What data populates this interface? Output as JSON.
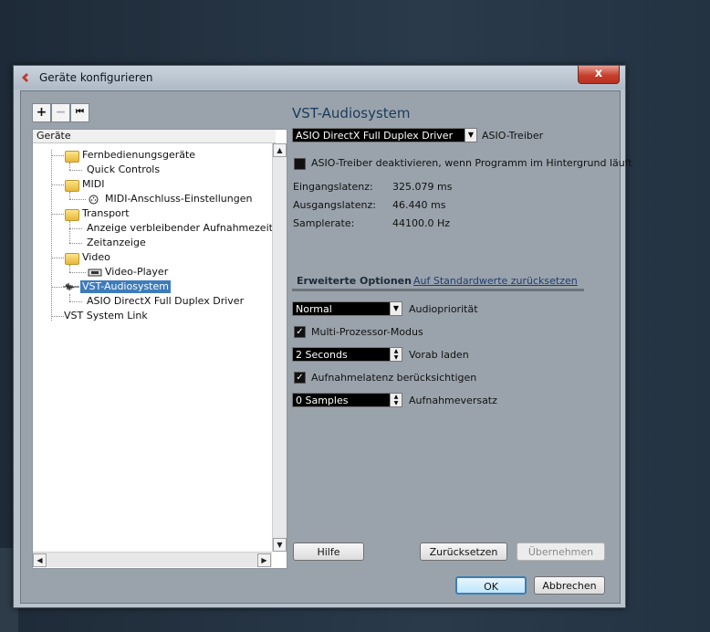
{
  "window": {
    "title": "Geräte konfigurieren",
    "close": "x"
  },
  "toolbar": {
    "add": "+",
    "remove": "−",
    "reset": "⏮"
  },
  "tree": {
    "header": "Geräte",
    "items": [
      {
        "label": "Fernbedienungsgeräte"
      },
      {
        "label": "Quick Controls"
      },
      {
        "label": "MIDI"
      },
      {
        "label": "MIDI-Anschluss-Einstellungen"
      },
      {
        "label": "Transport"
      },
      {
        "label": "Anzeige verbleibender Aufnahmezeit"
      },
      {
        "label": "Zeitanzeige"
      },
      {
        "label": "Video"
      },
      {
        "label": "Video-Player"
      },
      {
        "label": "VST-Audiosystem"
      },
      {
        "label": "ASIO DirectX Full Duplex Driver"
      },
      {
        "label": "VST System Link"
      }
    ]
  },
  "panel": {
    "title": "VST-Audiosystem",
    "driver_value": "ASIO DirectX Full Duplex Driver",
    "driver_label": "ASIO-Treiber",
    "deactivate_label": "ASIO-Treiber deaktivieren, wenn Programm im Hintergrund läuft",
    "in_latency_label": "Eingangslatenz:",
    "in_latency_value": "325.079 ms",
    "out_latency_label": "Ausgangslatenz:",
    "out_latency_value": "46.440 ms",
    "samplerate_label": "Samplerate:",
    "samplerate_value": "44100.0 Hz",
    "advanced_label": "Erweiterte Optionen",
    "defaults_link": "Auf Standardwerte zurücksetzen",
    "priority_value": "Normal",
    "priority_label": "Audiopriorität",
    "multiproc_label": "Multi-Prozessor-Modus",
    "preload_value": "2 Seconds",
    "preload_label": "Vorab laden",
    "latency_check_label": "Aufnahmelatenz berücksichtigen",
    "offset_value": "0 Samples",
    "offset_label": "Aufnahmeversatz"
  },
  "buttons": {
    "help": "Hilfe",
    "reset": "Zurücksetzen",
    "apply": "Übernehmen",
    "ok": "OK",
    "cancel": "Abbrechen"
  }
}
